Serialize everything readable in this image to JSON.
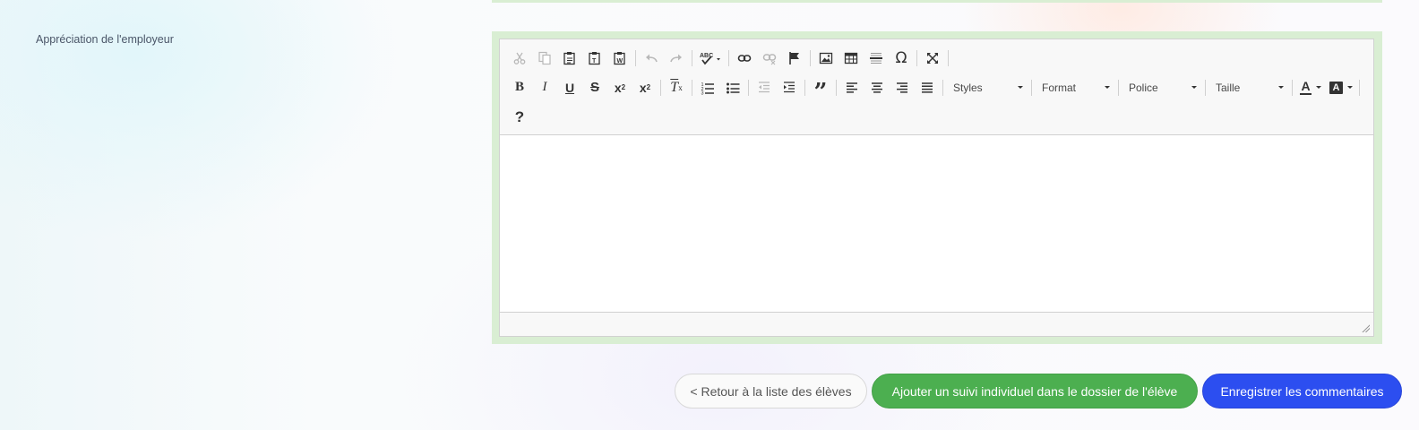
{
  "field": {
    "label": "Appréciation de l'employeur"
  },
  "editor": {
    "toolbar_row1": [
      {
        "icon": "cut-icon",
        "glyph": "✂",
        "disabled": true
      },
      {
        "icon": "copy-icon",
        "glyph": "⧉",
        "disabled": true
      },
      {
        "icon": "paste-icon",
        "glyph": "📋",
        "disabled": false
      },
      {
        "icon": "paste-text-icon",
        "glyph": "📋",
        "disabled": false
      },
      {
        "icon": "paste-word-icon",
        "glyph": "📋",
        "disabled": false
      },
      {
        "icon": "undo-icon",
        "glyph": "↶",
        "disabled": true
      },
      {
        "icon": "redo-icon",
        "glyph": "↷",
        "disabled": true
      },
      {
        "icon": "spellcheck-icon",
        "glyph": "ABC",
        "disabled": false
      },
      {
        "icon": "link-icon",
        "glyph": "🔗",
        "disabled": false
      },
      {
        "icon": "unlink-icon",
        "glyph": "⛓",
        "disabled": true
      },
      {
        "icon": "anchor-flag-icon",
        "glyph": "⚑",
        "disabled": false
      },
      {
        "icon": "image-icon",
        "glyph": "🖼",
        "disabled": false
      },
      {
        "icon": "table-icon",
        "glyph": "▦",
        "disabled": false
      },
      {
        "icon": "horizontal-line-icon",
        "glyph": "☰",
        "disabled": false
      },
      {
        "icon": "special-char-icon",
        "glyph": "Ω",
        "disabled": false
      },
      {
        "icon": "maximize-icon",
        "glyph": "⤢",
        "disabled": false
      }
    ],
    "toolbar_row2": {
      "bold": "B",
      "italic": "I",
      "underline": "U",
      "strike": "S",
      "subscript": "x₂",
      "superscript": "x²",
      "remove_format": "Tx",
      "numbered_list": "⒈",
      "bulleted_list": "•≡",
      "outdent": "⇤",
      "indent": "⇥",
      "blockquote": "❞",
      "align_left": "≡",
      "align_center": "≡",
      "align_right": "≡",
      "justify": "≡",
      "styles_label": "Styles",
      "format_label": "Format",
      "font_label": "Police",
      "size_label": "Taille",
      "text_color": "A",
      "bg_color": "A"
    },
    "toolbar_row3": {
      "help": "?"
    }
  },
  "actions": {
    "back_label": "< Retour à la liste des élèves",
    "add_label": "Ajouter un suivi individuel dans le dossier de l'élève",
    "save_label": "Enregistrer les commentaires"
  },
  "colors": {
    "frame_green": "#d9eed3",
    "add_button": "#4caf50",
    "save_button": "#2c4ef0"
  }
}
